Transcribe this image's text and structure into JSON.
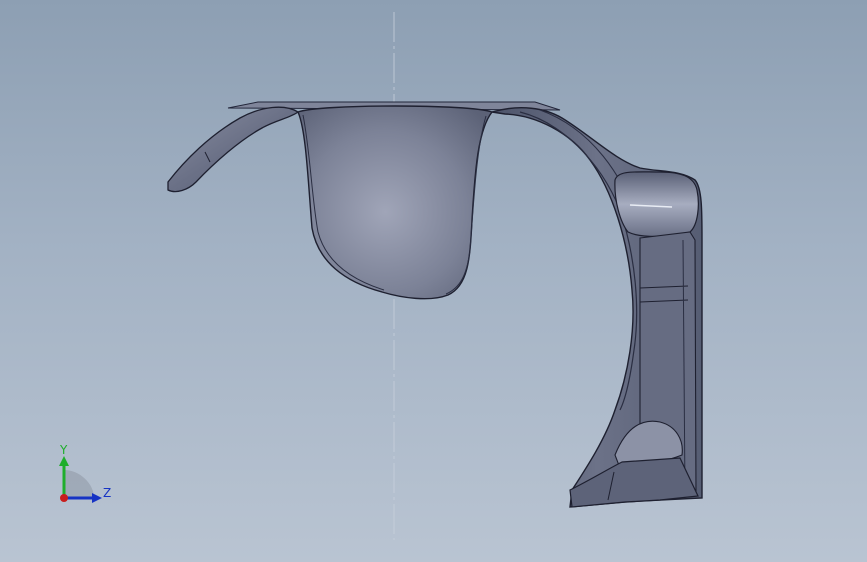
{
  "viewport": {
    "background_top": "#8d9fb3",
    "background_bottom": "#b9c4d2",
    "model_color": "#6e7488",
    "edge_color": "#1e2030"
  },
  "triad": {
    "y_label": "Y",
    "z_label": "Z",
    "y_color": "#1fae2c",
    "z_color": "#1633c4",
    "origin_color": "#c81e1e"
  }
}
